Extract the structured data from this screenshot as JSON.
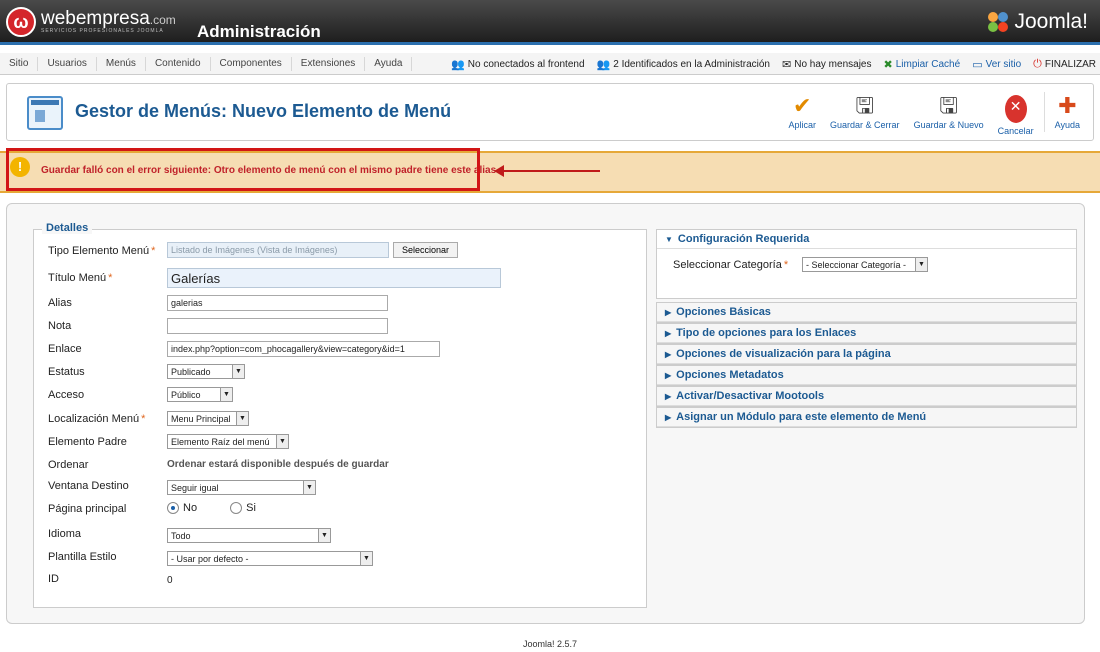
{
  "header": {
    "logo_mark": "ω",
    "logo_name": "webempresa",
    "logo_domain": ".com",
    "logo_tagline": "SERVICIOS PROFESIONALES JOOMLA",
    "title": "Administración",
    "brand": "Joomla!"
  },
  "menu": [
    "Sitio",
    "Usuarios",
    "Menús",
    "Contenido",
    "Componentes",
    "Extensiones",
    "Ayuda"
  ],
  "status": {
    "frontend": "No conectados al frontend",
    "admins": "2 Identificados en la Administración",
    "messages": "No hay mensajes",
    "cache": "Limpiar Caché",
    "view_site": "Ver sitio",
    "logout": "FINALIZAR"
  },
  "toolbar": {
    "title": "Gestor de Menús: Nuevo Elemento de Menú",
    "apply": "Aplicar",
    "save_close": "Guardar & Cerrar",
    "save_new": "Guardar & Nuevo",
    "cancel": "Cancelar",
    "help": "Ayuda"
  },
  "error": {
    "icon": "!",
    "message": "Guardar falló con el error siguiente: Otro elemento de menú con el mismo padre tiene este alias"
  },
  "details": {
    "legend": "Detalles",
    "type_label": "Tipo Elemento Menú",
    "type_value": "Listado de Imágenes (Vista de Imágenes)",
    "select_button": "Seleccionar",
    "title_label": "Título Menú",
    "title_value": "Galerías",
    "alias_label": "Alias",
    "alias_value": "galerias",
    "note_label": "Nota",
    "note_value": "",
    "link_label": "Enlace",
    "link_value": "index.php?option=com_phocagallery&view=category&id=1",
    "status_label": "Estatus",
    "status_value": "Publicado",
    "access_label": "Acceso",
    "access_value": "Público",
    "menu_location_label": "Localización Menú",
    "menu_location_value": "Menu Principal",
    "parent_label": "Elemento Padre",
    "parent_value": "Elemento Raíz del menú",
    "order_label": "Ordenar",
    "order_note": "Ordenar estará disponible después de guardar",
    "target_label": "Ventana Destino",
    "target_value": "Seguir igual",
    "home_label": "Página principal",
    "home_no": "No",
    "home_yes": "Si",
    "language_label": "Idioma",
    "language_value": "Todo",
    "template_label": "Plantilla Estilo",
    "template_value": "- Usar por defecto -",
    "id_label": "ID",
    "id_value": "0"
  },
  "right": {
    "required_title": "Configuración Requerida",
    "category_label": "Seleccionar Categoría",
    "category_value": "- Seleccionar Categoría -",
    "panels": [
      "Opciones Básicas",
      "Tipo de opciones para los Enlaces",
      "Opciones de visualización para la página",
      "Opciones Metadatos",
      "Activar/Desactivar Mootools",
      "Asignar un Módulo para este elemento de Menú"
    ]
  },
  "footer": "Joomla! 2.5.7",
  "colors": {
    "accent": "#1c5a92",
    "error": "#c0222a",
    "warning_bg": "#f6ddb3"
  }
}
